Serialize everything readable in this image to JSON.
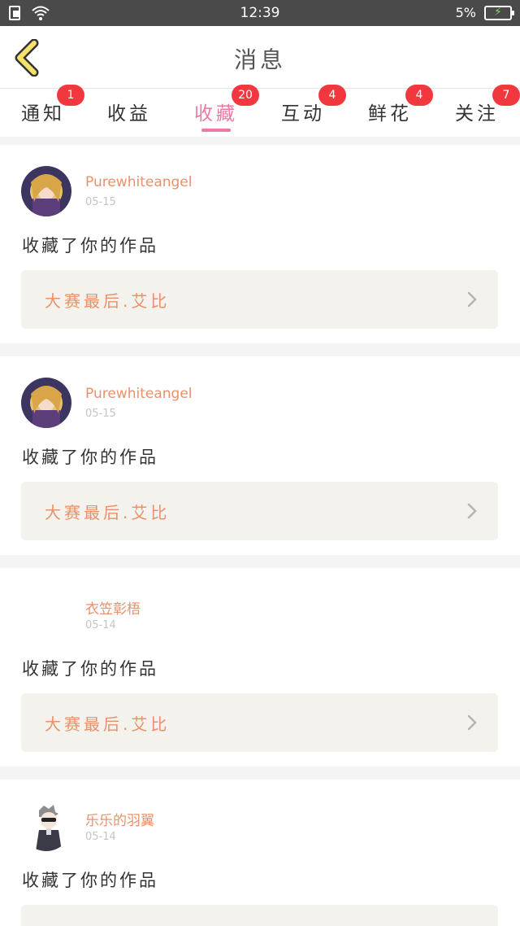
{
  "status_bar": {
    "time": "12:39",
    "battery": "5%",
    "icons": [
      "sim-icon",
      "wifi-icon",
      "battery-charging-icon"
    ]
  },
  "header": {
    "title": "消息",
    "back_icon": "chevron-left-icon"
  },
  "tabs": [
    {
      "label": "通知",
      "badge": "1",
      "active": false
    },
    {
      "label": "收益",
      "badge": "",
      "active": false
    },
    {
      "label": "收藏",
      "badge": "20",
      "active": true
    },
    {
      "label": "互动",
      "badge": "4",
      "active": false
    },
    {
      "label": "鲜花",
      "badge": "4",
      "active": false
    },
    {
      "label": "关注",
      "badge": "7",
      "active": false
    }
  ],
  "messages": [
    {
      "username": "Purewhiteangel",
      "date": "05-15",
      "action": "收藏了你的作品",
      "work_title": "大赛最后.艾比"
    },
    {
      "username": "Purewhiteangel",
      "date": "05-15",
      "action": "收藏了你的作品",
      "work_title": "大赛最后.艾比"
    },
    {
      "username": "衣笠彰梧",
      "date": "05-14",
      "action": "收藏了你的作品",
      "work_title": "大赛最后.艾比"
    },
    {
      "username": "乐乐的羽翼",
      "date": "05-14",
      "action": "收藏了你的作品",
      "work_title": ""
    }
  ],
  "colors": {
    "accent_pink": "#e97aa4",
    "username_orange": "#e8916a",
    "badge_red": "#f0383e",
    "back_yellow": "#f5e26a"
  }
}
